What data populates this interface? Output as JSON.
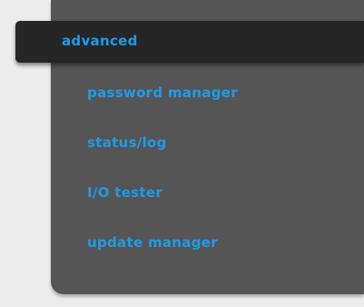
{
  "menu": {
    "active_item": "advanced",
    "items": [
      {
        "label": "password manager"
      },
      {
        "label": "status/log"
      },
      {
        "label": "I/O tester"
      },
      {
        "label": "update manager"
      }
    ]
  },
  "colors": {
    "panel": "#555555",
    "active_background": "#262626",
    "link": "#1e9be8",
    "page_background": "#ececec"
  }
}
